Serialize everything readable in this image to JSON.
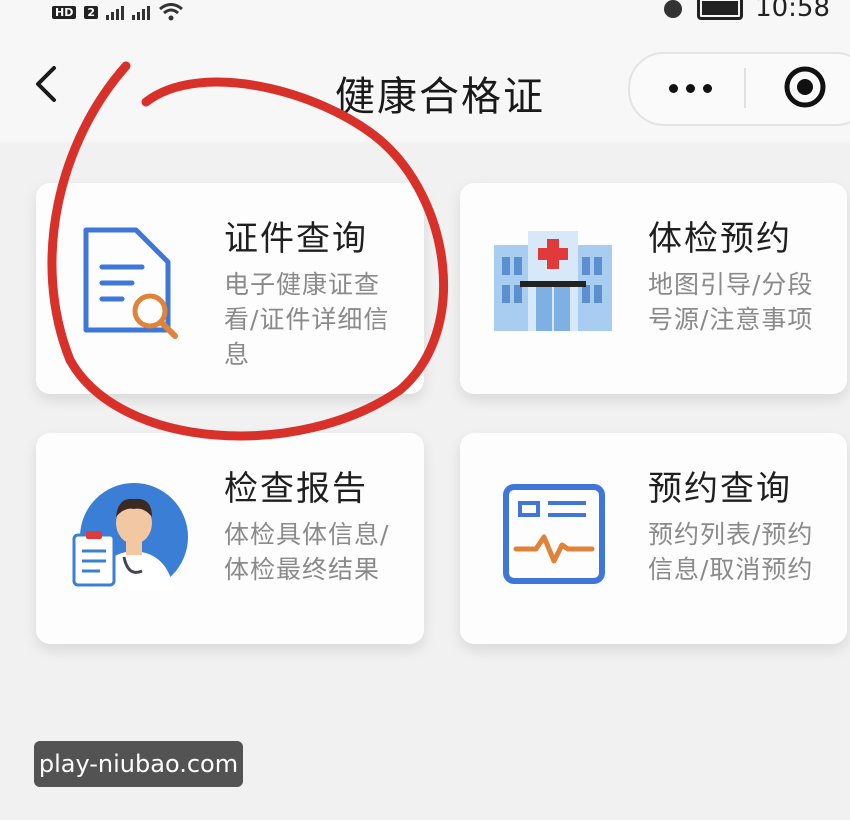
{
  "status_bar": {
    "network_label": "HD",
    "sim_label": "2",
    "time": "10:58"
  },
  "nav": {
    "title": "健康合格证"
  },
  "cards": [
    {
      "title": "证件查询",
      "desc": "电子健康证查看/证件详细信息",
      "icon": "document-search-icon"
    },
    {
      "title": "体检预约",
      "desc": "地图引导/分段号源/注意事项",
      "icon": "hospital-icon"
    },
    {
      "title": "检查报告",
      "desc": "体检具体信息/体检最终结果",
      "icon": "doctor-icon"
    },
    {
      "title": "预约查询",
      "desc": "预约列表/预约信息/取消预约",
      "icon": "monitor-pulse-icon"
    }
  ],
  "colors": {
    "accent_blue": "#3f76d9",
    "accent_orange": "#e0823a",
    "annotation_red": "#d8312a",
    "hospital_red": "#e03a3a"
  },
  "watermark": {
    "text": "play-niubao.com"
  }
}
